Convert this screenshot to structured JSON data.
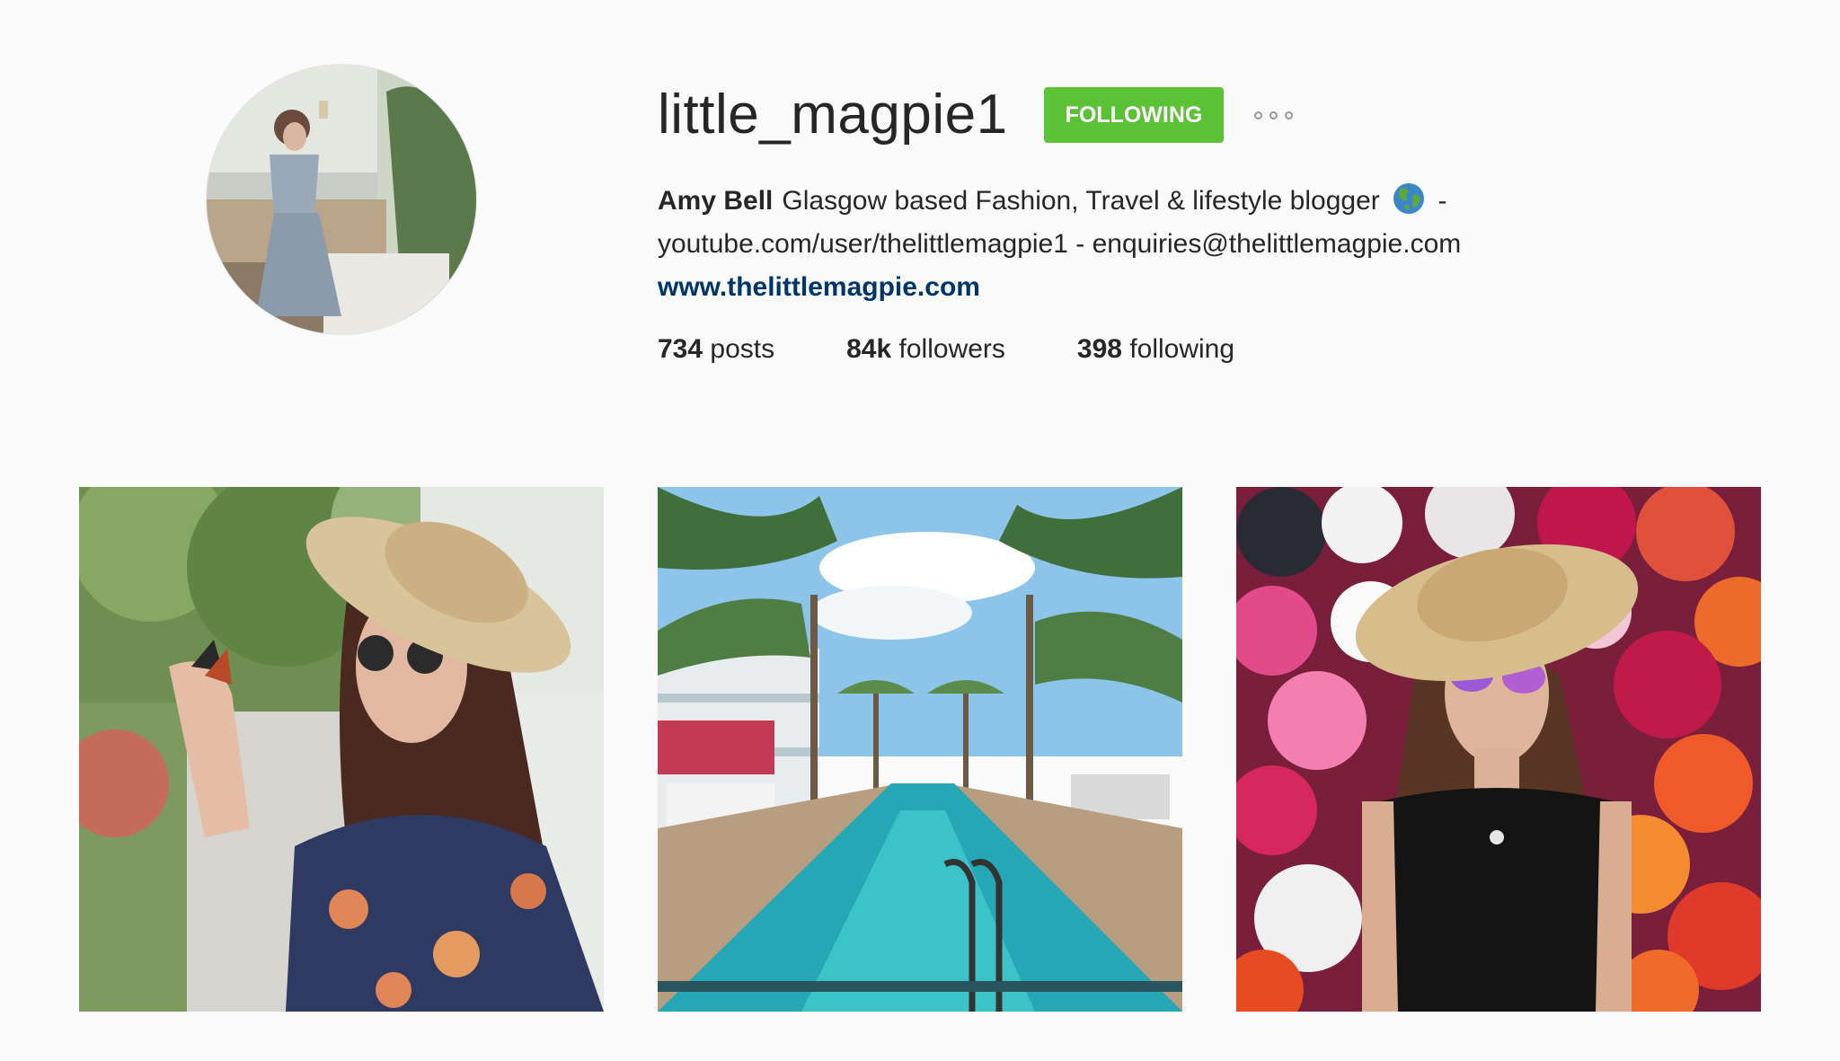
{
  "profile": {
    "username": "little_magpie1",
    "follow_button": "FOLLOWING",
    "follow_color": "#5bc236",
    "more_icon": "ellipsis-icon",
    "avatar_alt": "profile-photo",
    "bio": {
      "name": "Amy Bell",
      "text_line1": "Glasgow based Fashion, Travel & lifestyle blogger",
      "emoji": "globe-icon",
      "dash": "-",
      "text_line2": "youtube.com/user/thelittlemagpie1 - enquiries@thelittlemagpie.com",
      "website": "www.thelittlemagpie.com",
      "link_color": "#003569"
    },
    "stats": {
      "posts_count": "734",
      "posts_label": "posts",
      "followers_count": "84k",
      "followers_label": "followers",
      "following_count": "398",
      "following_label": "following"
    }
  },
  "posts": [
    {
      "subject": "woman-in-straw-hat-with-butterfly"
    },
    {
      "subject": "palm-lined-pool"
    },
    {
      "subject": "woman-in-straw-hat-with-flower-wall"
    }
  ]
}
